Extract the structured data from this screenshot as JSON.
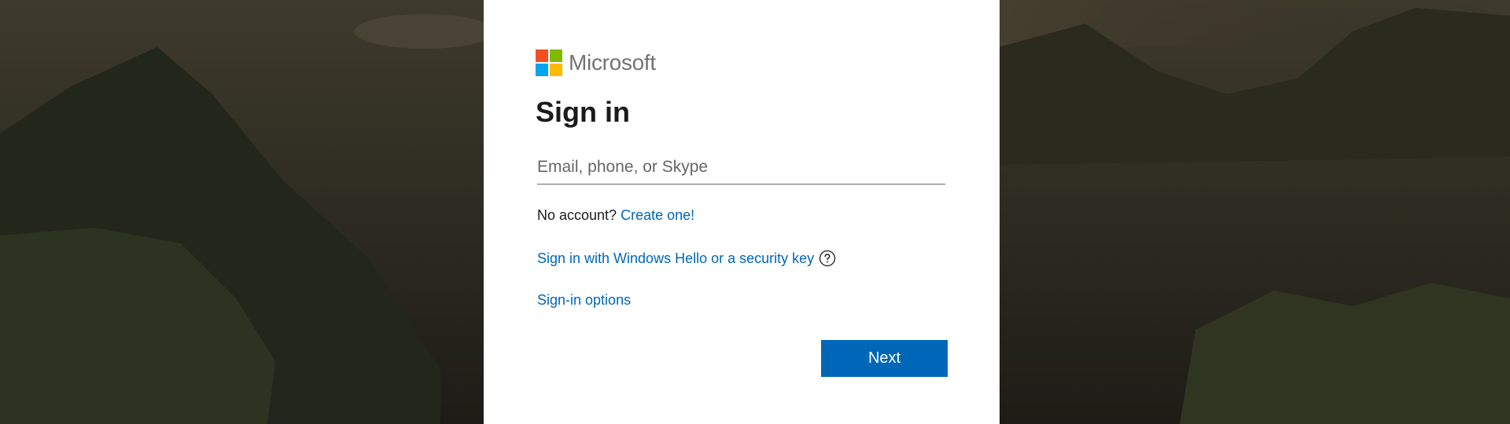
{
  "brand": {
    "name": "Microsoft",
    "colors": [
      "#f25022",
      "#7fba00",
      "#00a4ef",
      "#ffb900"
    ],
    "text_color": "#737373"
  },
  "form": {
    "title": "Sign in",
    "email": {
      "value": "",
      "placeholder": "Email, phone, or Skype"
    },
    "no_account_text": "No account?",
    "create_link": "Create one!",
    "windows_hello_link": "Sign in with Windows Hello or a security key",
    "help_icon": "question-circle-icon",
    "signin_options_link": "Sign-in options",
    "next_button": "Next"
  },
  "colors": {
    "accent": "#0067b8",
    "card_background": "#ffffff",
    "page_background": "#1f1e19"
  }
}
